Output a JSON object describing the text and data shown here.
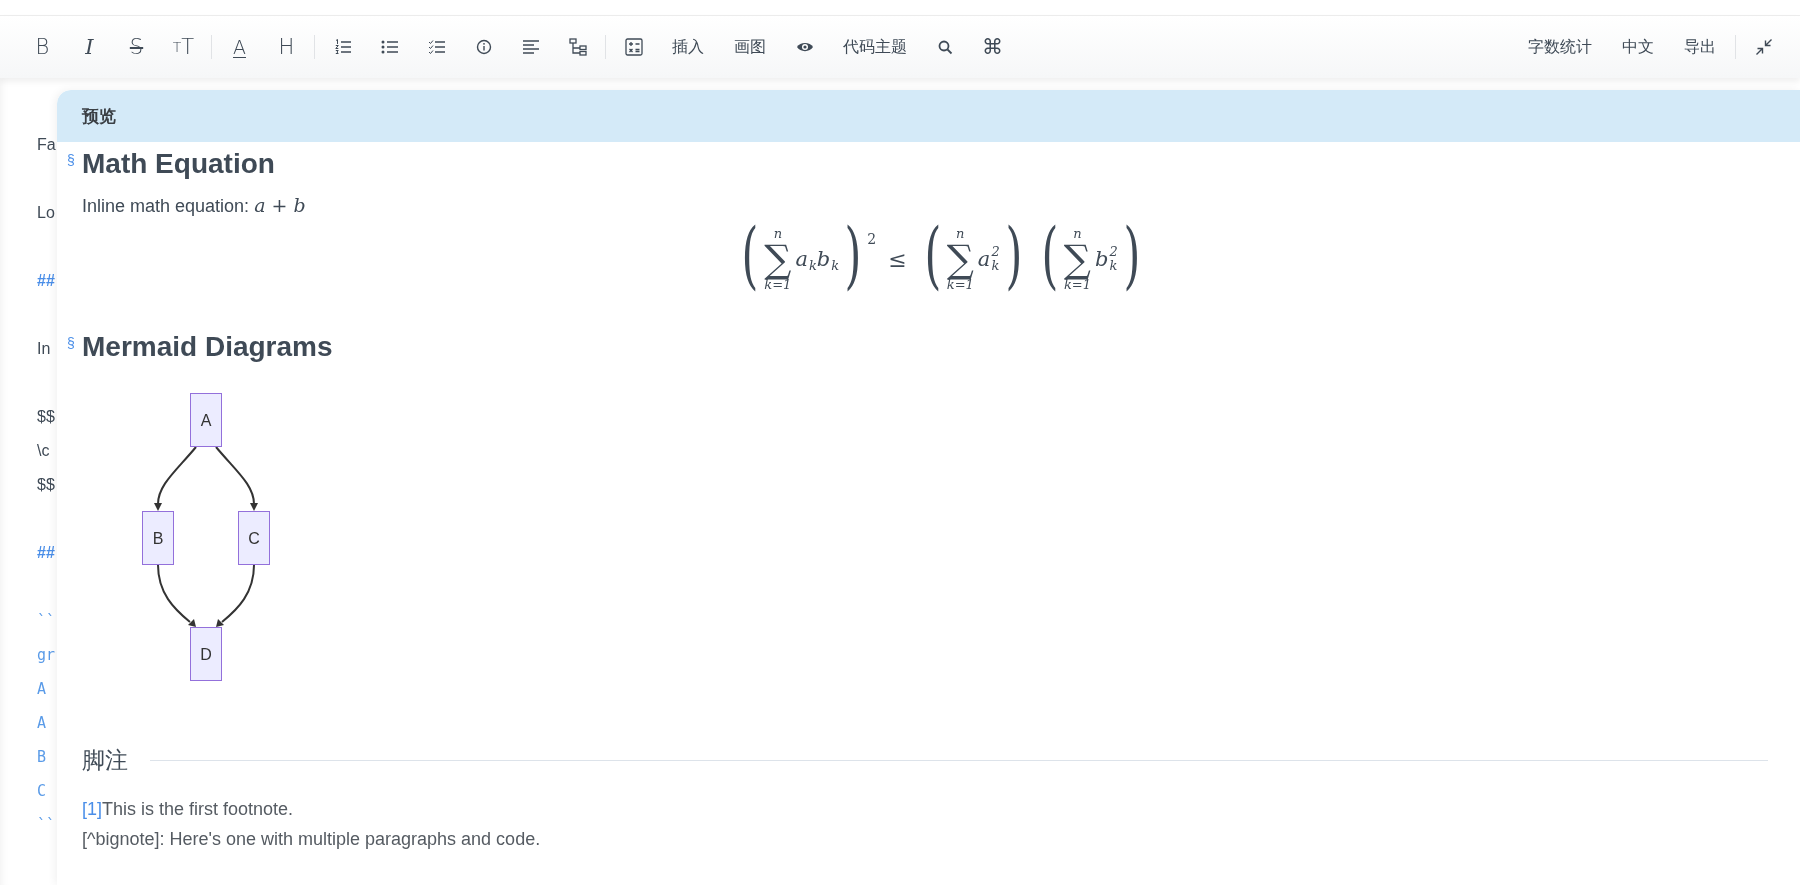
{
  "toolbar": {
    "left": [
      {
        "kind": "glyph",
        "glyph": "B"
      },
      {
        "kind": "italic",
        "glyph": "I"
      },
      {
        "kind": "strike",
        "glyph": "S"
      },
      {
        "kind": "size",
        "glyph": "TT"
      },
      {
        "kind": "separator"
      },
      {
        "kind": "underline",
        "glyph": "A"
      },
      {
        "kind": "glyph",
        "glyph": "H"
      },
      {
        "kind": "separator"
      },
      {
        "kind": "icon"
      },
      {
        "kind": "icon"
      },
      {
        "kind": "icon"
      },
      {
        "kind": "icon"
      },
      {
        "kind": "icon"
      },
      {
        "kind": "icon"
      },
      {
        "kind": "separator"
      },
      {
        "kind": "icon"
      },
      {
        "kind": "label",
        "label": "插入"
      },
      {
        "kind": "label",
        "label": "画图"
      },
      {
        "kind": "icon"
      },
      {
        "kind": "label",
        "label": "代码主题"
      },
      {
        "kind": "icon"
      },
      {
        "kind": "glyph",
        "glyph": "⌘"
      }
    ],
    "right": [
      {
        "kind": "label",
        "label": "字数统计"
      },
      {
        "kind": "label",
        "label": "中文"
      },
      {
        "kind": "label",
        "label": "导出"
      },
      {
        "kind": "separator"
      },
      {
        "kind": "icon"
      }
    ]
  },
  "editor": {
    "lines": [
      {
        "kind": "text",
        "text": "Fa"
      },
      {
        "kind": "text",
        "text": "Lo"
      },
      {
        "kind": "heading",
        "text": "##"
      },
      {
        "kind": "text",
        "text": "In"
      },
      {
        "kind": "text",
        "text": "$$"
      },
      {
        "kind": "text",
        "text": "\\c"
      },
      {
        "kind": "text",
        "text": "$$"
      },
      {
        "kind": "heading",
        "text": "##"
      },
      {
        "kind": "code",
        "text": "``"
      },
      {
        "kind": "code",
        "text": "gr"
      },
      {
        "kind": "code",
        "text": "A"
      },
      {
        "kind": "code",
        "text": "A"
      },
      {
        "kind": "code",
        "text": "B"
      },
      {
        "kind": "code",
        "text": "C"
      },
      {
        "kind": "code",
        "text": "``"
      }
    ]
  },
  "preview": {
    "title": "预览",
    "sections": [
      {
        "kind": "heading",
        "anchor": "§",
        "text": "Math Equation"
      },
      {
        "kind": "paragraph",
        "text": "Inline math equation: ",
        "math": "a + b"
      },
      {
        "kind": "equation",
        "parts": [
          {
            "kind": "group",
            "open": "(",
            "close": ")",
            "upper": "n",
            "operator": "∑",
            "lower": "k=1",
            "terms": [
              {
                "base": "a",
                "sub": "k"
              },
              {
                "base": "b",
                "sub": "k"
              }
            ],
            "power": "2"
          },
          {
            "kind": "relation",
            "symbol": "≤"
          },
          {
            "kind": "group",
            "open": "(",
            "close": ")",
            "upper": "n",
            "operator": "∑",
            "lower": "k=1",
            "terms": [
              {
                "base": "a",
                "sub": "k",
                "sup": "2"
              }
            ]
          },
          {
            "kind": "group",
            "open": "(",
            "close": ")",
            "upper": "n",
            "operator": "∑",
            "lower": "k=1",
            "terms": [
              {
                "base": "b",
                "sub": "k",
                "sup": "2"
              }
            ]
          }
        ]
      },
      {
        "kind": "heading",
        "anchor": "§",
        "text": "Mermaid Diagrams"
      },
      {
        "kind": "diagram",
        "nodes": [
          {
            "label": "A"
          },
          {
            "label": "B"
          },
          {
            "label": "C"
          },
          {
            "label": "D"
          }
        ]
      }
    ],
    "footnotes": {
      "title": "脚注",
      "items": [
        {
          "mark": "[1]",
          "text": "This is the first footnote."
        },
        {
          "text": "[^bignote]: Here's one with multiple paragraphs and code."
        }
      ]
    }
  }
}
